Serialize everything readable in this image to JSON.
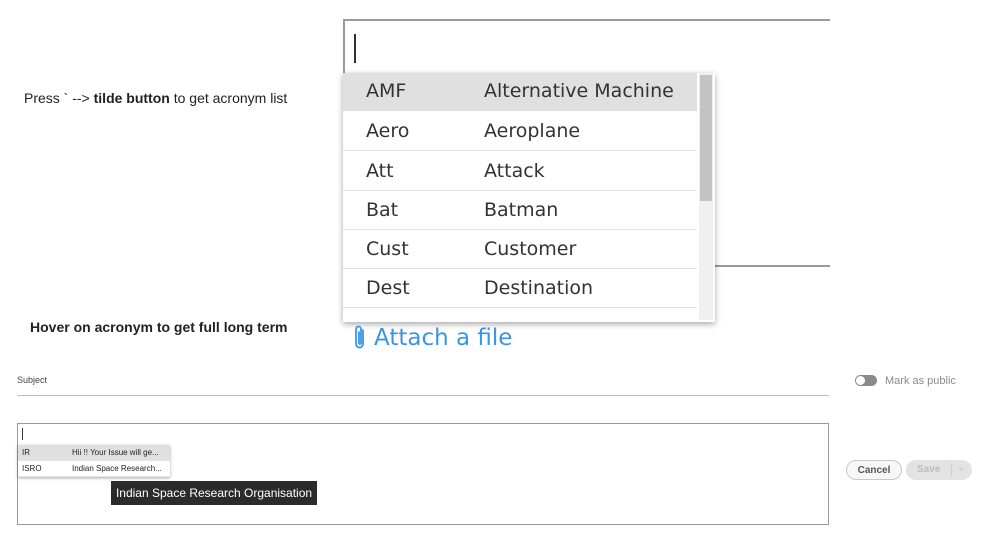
{
  "instructions": {
    "line1_pre": "Press ` --> ",
    "line1_bold": "tilde button",
    "line1_post": " to get acronym list",
    "line2": "Hover on acronym to get full long term"
  },
  "zoom_dropdown": {
    "items": [
      {
        "acronym": "AMF",
        "term": "Alternative Machine"
      },
      {
        "acronym": "Aero",
        "term": "Aeroplane"
      },
      {
        "acronym": "Att",
        "term": "Attack"
      },
      {
        "acronym": "Bat",
        "term": "Batman"
      },
      {
        "acronym": "Cust",
        "term": "Customer"
      },
      {
        "acronym": "Dest",
        "term": "Destination"
      }
    ]
  },
  "attach": {
    "label": "Attach a file"
  },
  "form": {
    "subject_label": "Subject",
    "mark_public_label": "Mark as public",
    "small_dropdown": {
      "items": [
        {
          "acronym": "IR",
          "term": "Hii !! Your Issue will ge..."
        },
        {
          "acronym": "ISRO",
          "term": "Indian Space Research..."
        }
      ]
    },
    "tooltip": "Indian Space Research Organisation",
    "cancel_label": "Cancel",
    "save_label": "Save"
  },
  "colors": {
    "link": "#3b95e6",
    "tooltip_bg": "#2b2b2b",
    "selected_row": "#e0e0e0"
  }
}
